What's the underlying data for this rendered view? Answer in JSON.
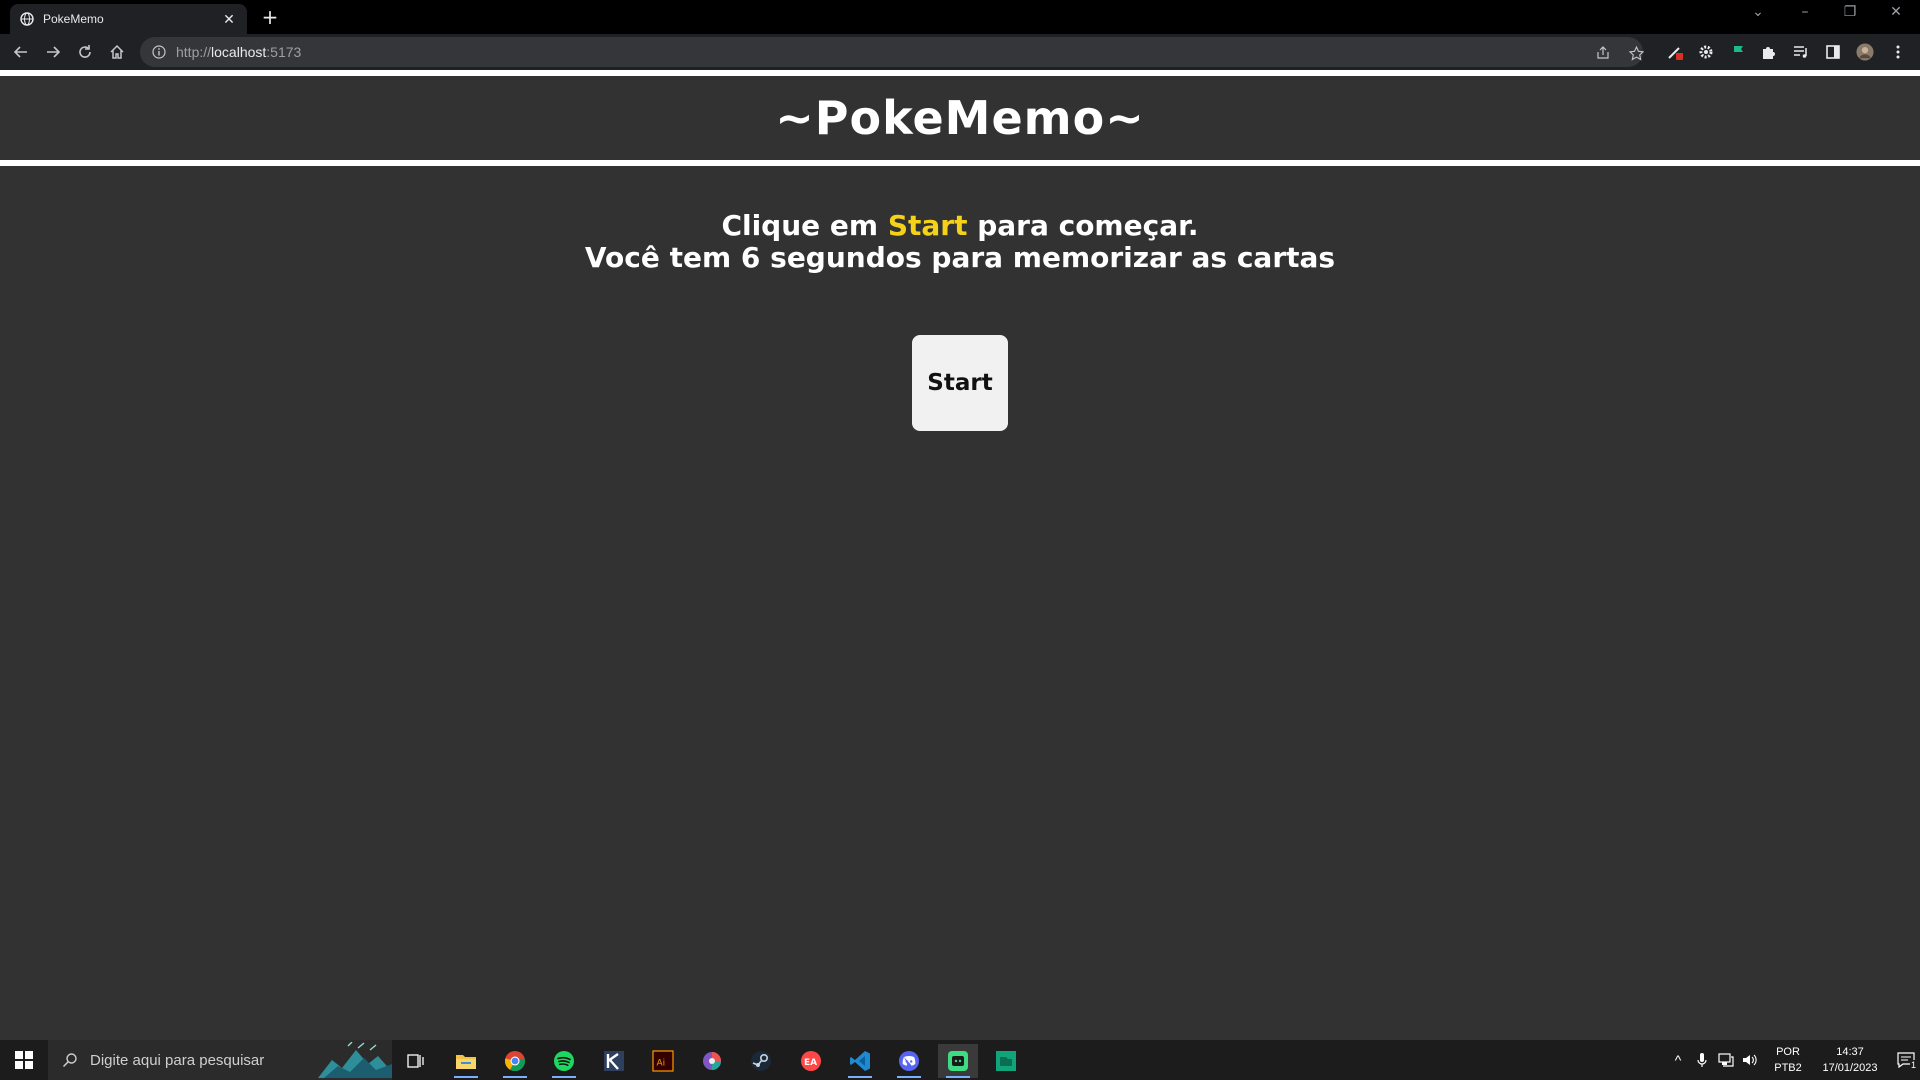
{
  "browser": {
    "tab_title": "PokeMemo",
    "tab_close_icon": "close-icon",
    "new_tab_icon": "plus-icon",
    "url_scheme": "http://",
    "url_host": "localhost",
    "url_port": ":5173",
    "window_controls": [
      "chevron-down-icon",
      "minimize-icon",
      "restore-icon",
      "close-icon"
    ]
  },
  "page": {
    "title": "~PokeMemo~",
    "instruction_prefix": "Clique em ",
    "instruction_highlight": "Start",
    "instruction_suffix": " para começar.",
    "instruction_line2": "Você tem 6 segundos para memorizar as cartas",
    "start_label": "Start",
    "colors": {
      "background": "#323232",
      "highlight": "#f5d21a",
      "button": "#f1f1f1"
    }
  },
  "taskbar": {
    "search_placeholder": "Digite aqui para pesquisar",
    "apps": [
      "task-view-icon",
      "file-explorer-icon",
      "chrome-icon",
      "spotify-icon",
      "krita-icon",
      "illustrator-icon",
      "browser-icon",
      "steam-icon",
      "ea-icon",
      "vscode-icon",
      "discord-icon",
      "android-studio-icon",
      "app-icon"
    ],
    "lang_top": "POR",
    "lang_bottom": "PTB2",
    "time": "14:37",
    "date": "17/01/2023",
    "notification_count": "1"
  }
}
